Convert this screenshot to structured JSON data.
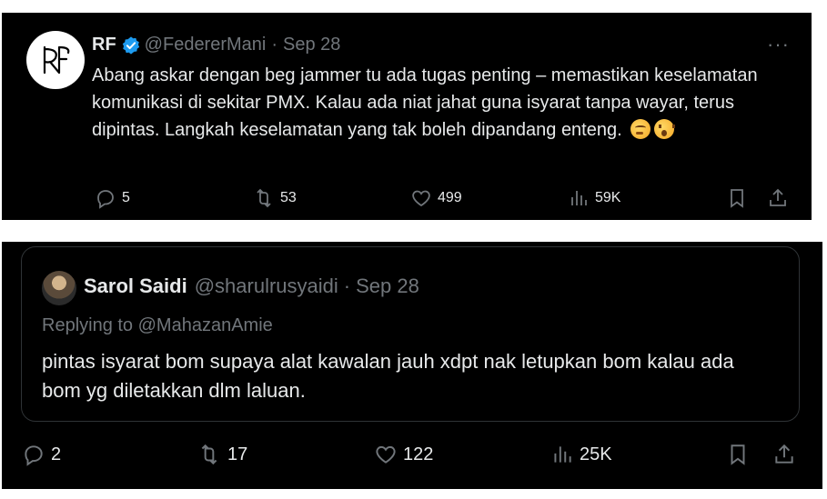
{
  "tweet1": {
    "name": "RF",
    "handle": "@FedererMani",
    "separator": "·",
    "date": "Sep 28",
    "more": "···",
    "text": "Abang askar dengan beg jammer tu ada tugas penting – memastikan keselamatan komunikasi di sekitar PMX. Kalau ada niat jahat guna isyarat tanpa wayar, terus dipintas. Langkah keselamatan yang tak boleh dipandang enteng.",
    "emojis": [
      "thinking-face",
      "astonished-face"
    ],
    "replies": "5",
    "reposts": "53",
    "likes": "499",
    "views": "59K"
  },
  "tweet2": {
    "name": "Sarol Saidi",
    "handle": "@sharulrusyaidi",
    "separator": "·",
    "date": "Sep 28",
    "replying_to": "Replying to @MahazanAmie",
    "text": "pintas isyarat bom supaya alat kawalan jauh xdpt nak letupkan bom kalau ada bom yg diletakkan dlm laluan.",
    "replies": "2",
    "reposts": "17",
    "likes": "122",
    "views": "25K"
  },
  "colors": {
    "background": "#000000",
    "text": "#e7e9ea",
    "muted": "#71767b",
    "verified": "#1d9bf0",
    "border": "#2f3336"
  }
}
